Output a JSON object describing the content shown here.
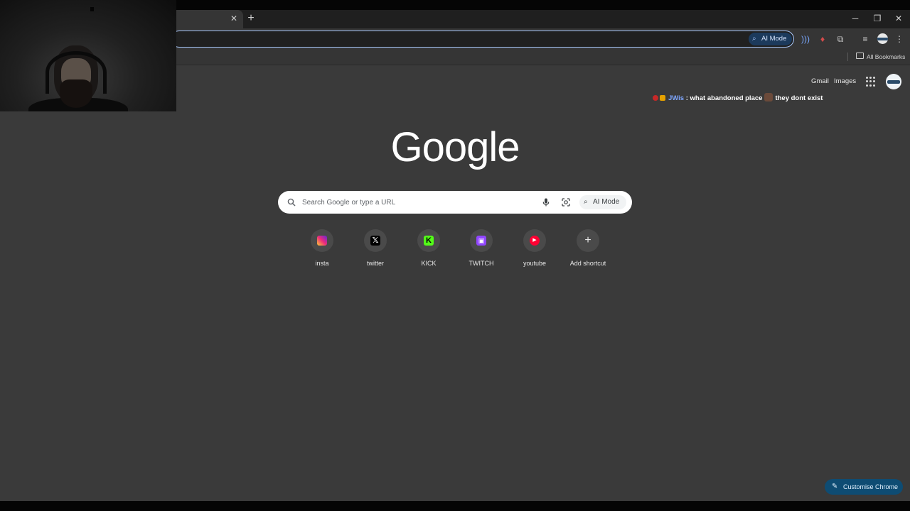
{
  "browser": {
    "tab_close_icon": "close-icon",
    "new_tab_icon": "plus-icon",
    "window_controls": [
      "minimize",
      "restore",
      "close"
    ],
    "omnibox_ai_mode_label": "AI Mode",
    "bookmarks_bar": {
      "all_bookmarks_label": "All Bookmarks"
    }
  },
  "ntp": {
    "header_links": {
      "gmail": "Gmail",
      "images": "Images"
    },
    "logo_text": "Google",
    "search": {
      "placeholder": "Search Google or type a URL",
      "ai_mode_label": "AI Mode"
    },
    "shortcuts": [
      {
        "label": "insta",
        "icon": "instagram-icon"
      },
      {
        "label": "twitter",
        "icon": "x-icon",
        "glyph": "𝕏"
      },
      {
        "label": "KICK",
        "icon": "kick-icon",
        "glyph": "K"
      },
      {
        "label": "TWITCH",
        "icon": "twitch-icon",
        "glyph": "▣"
      },
      {
        "label": "youtube",
        "icon": "youtube-icon",
        "glyph": "▶"
      },
      {
        "label": "Add shortcut",
        "icon": "plus-icon",
        "glyph": "+"
      }
    ],
    "customise_label": "Customise Chrome"
  },
  "chat_overlay": {
    "username": "JWis",
    "separator": " : ",
    "message_part1": "what abandoned place",
    "message_part2": "they dont exist"
  },
  "colors": {
    "page_background": "#3a3a3a",
    "toolbar": "#353535",
    "omnibox_border": "#a8c7fa",
    "chat_username": "#7ea6ff",
    "customise_button": "#0e4c73"
  }
}
